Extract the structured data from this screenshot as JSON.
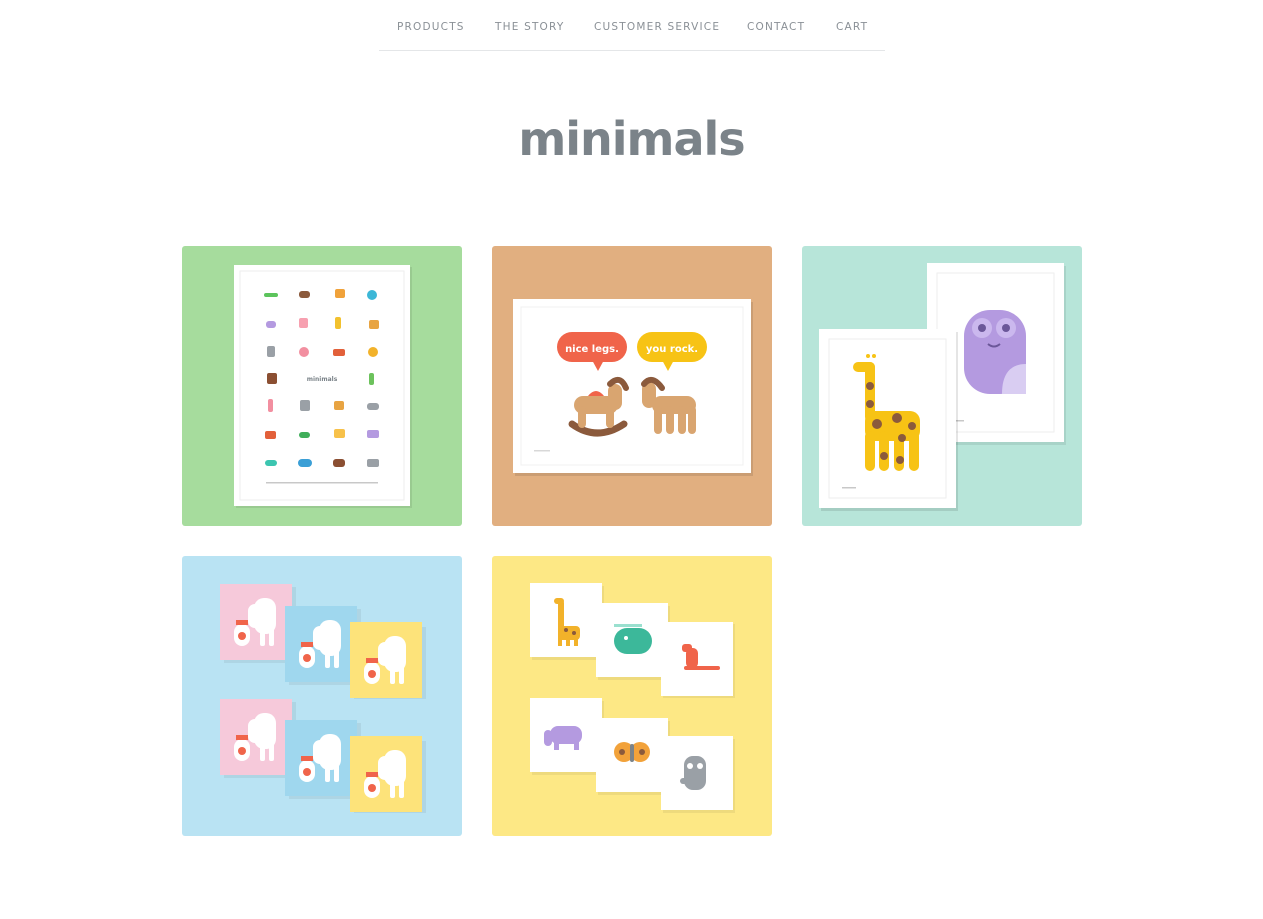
{
  "nav": {
    "items": [
      {
        "label": "PRODUCTS"
      },
      {
        "label": "THE STORY"
      },
      {
        "label": "CUSTOMER SERVICE"
      },
      {
        "label": "CONTACT"
      },
      {
        "label": "CART"
      }
    ]
  },
  "brand": {
    "logo": "minimals"
  },
  "products": [
    {
      "name": "animal-poster",
      "bg": "#a6dc9d",
      "poster_label": "minimals"
    },
    {
      "name": "rocking-horse-print",
      "bg": "#e1af80",
      "bubble_left": "nice legs.",
      "bubble_right": "you rock."
    },
    {
      "name": "giraffe-owl-prints",
      "bg": "#b7e5d9"
    },
    {
      "name": "elephant-cards",
      "bg": "#b9e3f3"
    },
    {
      "name": "animal-card-set",
      "bg": "#fde885"
    }
  ],
  "colors": {
    "text": "#7a8086",
    "divider": "#e4e6e8",
    "bubble_left": "#f0644a",
    "bubble_right": "#f7c315"
  }
}
